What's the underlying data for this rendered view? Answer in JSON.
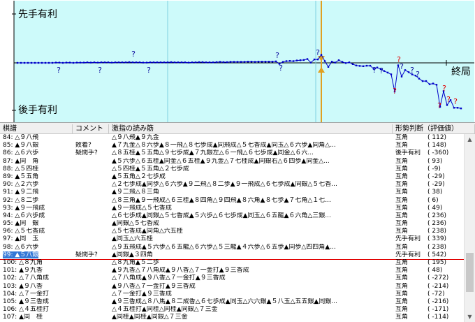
{
  "graph": {
    "top_label": "先手有利",
    "bottom_label": "後手有利",
    "end_label": "終局",
    "question_mark": "?",
    "colors": {
      "background": "#cdfafa",
      "line": "#0000c8",
      "dot": "#0000c8",
      "current": "#e0a020",
      "grid": "#80d0e0",
      "question_blue": "#1010a0",
      "question_red": "#e00000"
    }
  },
  "table": {
    "headers": [
      "棋譜",
      "コメント",
      "激指の読み筋",
      "形勢判断（評価値）"
    ],
    "rows": [
      {
        "move": "84: △９八飛",
        "comment": "",
        "line": "△９八飛▲９九金",
        "judge": "互角",
        "value": "(    112)"
      },
      {
        "move": "85: ▲９八銀",
        "comment": "敗着?",
        "line": "▲７九金△８六歩▲８一飛△８七歩成▲同飛成△５七香成▲同玉△６六歩▲同角△...",
        "judge": "互角",
        "value": "(    148)"
      },
      {
        "move": "86: △６六歩",
        "comment": "疑問手?",
        "line": "△８五桂▲５五角△９七歩成▲７九銀左△６一飛△６七歩成▲同金△６六...",
        "judge": "後手有利",
        "value": "(   -360)"
      },
      {
        "move": "87: ▲同　角",
        "comment": "",
        "line": "▲５六歩△６五桂▲同金△６五桂▲９九金△７七桂成▲同銀右△６四歩▲同金△...",
        "judge": "互角",
        "value": "(     93)"
      },
      {
        "move": "88: △５四桂",
        "comment": "",
        "line": "△５四桂▲５五角△２七歩成",
        "judge": "互角",
        "value": "(     -9)"
      },
      {
        "move": "89: ▲５五角",
        "comment": "",
        "line": "▲５五角△２七歩成",
        "judge": "互角",
        "value": "(    -29)"
      },
      {
        "move": "90: △２六歩",
        "comment": "",
        "line": "△２七歩成▲同歩△６六歩▲９二飛△８二歩▲９一飛成△６七歩成▲同銀△５七香...",
        "judge": "互角",
        "value": "(    -29)"
      },
      {
        "move": "91: ▲９二飛",
        "comment": "",
        "line": "▲９二飛△８三角",
        "judge": "互角",
        "value": "(     38)"
      },
      {
        "move": "92: △８二歩",
        "comment": "",
        "line": "△８三角▲９一飛成△６三桂▲８四角△９四飛▲８六角▲８七歩▲７七角△１七...",
        "judge": "互角",
        "value": "(      6)"
      },
      {
        "move": "93: ▲９一飛成",
        "comment": "",
        "line": "▲９一飛成△５七香成",
        "judge": "互角",
        "value": "(     49)"
      },
      {
        "move": "94: △６六歩成",
        "comment": "",
        "line": "△６七歩成▲同銀△５七香成▲５六歩△６七歩成▲同玉△６五龍▲６六角△三銀...",
        "judge": "互角",
        "value": "(    236)"
      },
      {
        "move": "95: ▲同　銀",
        "comment": "",
        "line": "▲同銀△５七香成",
        "judge": "互角",
        "value": "(    236)"
      },
      {
        "move": "96: △５七香成",
        "comment": "",
        "line": "△５七香成▲同角△六五桂",
        "judge": "互角",
        "value": "(    238)"
      },
      {
        "move": "97: ▲同　玉",
        "comment": "",
        "line": "▲同玉△六五桂",
        "judge": "先手有利",
        "value": "(    339)"
      },
      {
        "move": "98: △６六歩",
        "comment": "",
        "line": "△９五飛成▲５六歩△６五龍△６六歩△５三龍▲４六歩△６五歩▲同歩△四四角▲...",
        "judge": "互角",
        "value": "(    238)"
      },
      {
        "move": "99: ▲５八銀",
        "comment": "疑問手?",
        "line": "▲同銀▲３四角",
        "judge": "先手有利",
        "value": "(    542)",
        "selected": true
      },
      {
        "move": "100: △８九角",
        "comment": "",
        "line": "△８九角▲５二歩",
        "judge": "互角",
        "value": "(    195)"
      },
      {
        "move": "101: ▲９九香",
        "comment": "",
        "line": "▲９九香△７八角成▲９八香△７一金打▲９三香成",
        "judge": "互角",
        "value": "(     48)"
      },
      {
        "move": "102: △７八角成",
        "comment": "",
        "line": "△７八角成▲９八香△７一金打▲９三香成",
        "judge": "互角",
        "value": "(   -272)"
      },
      {
        "move": "103: ▲９八香",
        "comment": "",
        "line": "▲９八香△７一金打▲９三香成",
        "judge": "互角",
        "value": "(   -214)"
      },
      {
        "move": "104: △７一金打",
        "comment": "",
        "line": "△７一金打▲９三香成",
        "judge": "互角",
        "value": "(    -72)"
      },
      {
        "move": "105: ▲９三香成",
        "comment": "",
        "line": "▲９三香成△８八馬▲８二成香△６七歩成▲同玉△六六銀▲５八玉△五五銀▲同銀...",
        "judge": "互角",
        "value": "(   -216)"
      },
      {
        "move": "106: △４五桂打",
        "comment": "",
        "line": "△４五桂打▲同桂△同桂▲同銀△７三金",
        "judge": "互角",
        "value": "(   -171)"
      },
      {
        "move": "107: ▲同　桂",
        "comment": "",
        "line": "▲同桂▲同桂▲同銀△７三金",
        "judge": "互角",
        "value": "(   -114)"
      }
    ]
  }
}
